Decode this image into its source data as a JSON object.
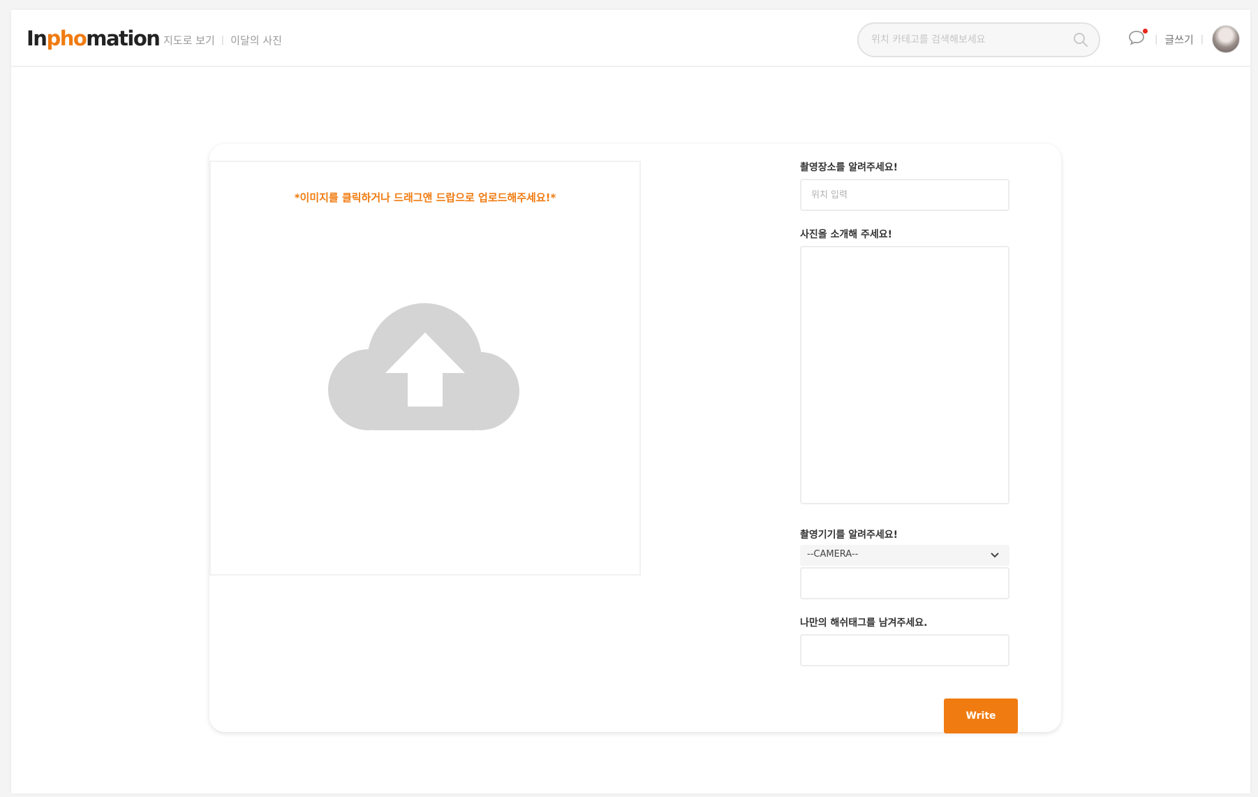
{
  "header": {
    "logo_prefix": "In",
    "logo_accent": "pho",
    "logo_suffix": "mation",
    "nav": {
      "map_view": "지도로 보기",
      "separator": "|",
      "monthly_photo": "이달의 사진"
    },
    "search": {
      "placeholder": "위치 카테고를 검색해보세요"
    },
    "write_link": "글쓰기",
    "separator": "|"
  },
  "upload": {
    "hint": "*이미지를 클릭하거나 드래그앤 드랍으로 업로드해주세요!*",
    "icon": "cloud-upload-icon"
  },
  "form": {
    "location_label": "촬영장소를 알려주세요!",
    "location_placeholder": "위치 입력",
    "description_label": "사진을 소개해 주세요!",
    "device_label": "촬영기기를 알려주세요!",
    "device_selected": "--CAMERA--",
    "device_value": "",
    "hashtag_label": "나만의 해쉬태그를 남겨주세요.",
    "hashtag_value": "",
    "submit_label": "Write"
  },
  "colors": {
    "accent": "#f07b10",
    "notification_dot": "#e8261b",
    "icon_gray": "#d4d4d4"
  }
}
